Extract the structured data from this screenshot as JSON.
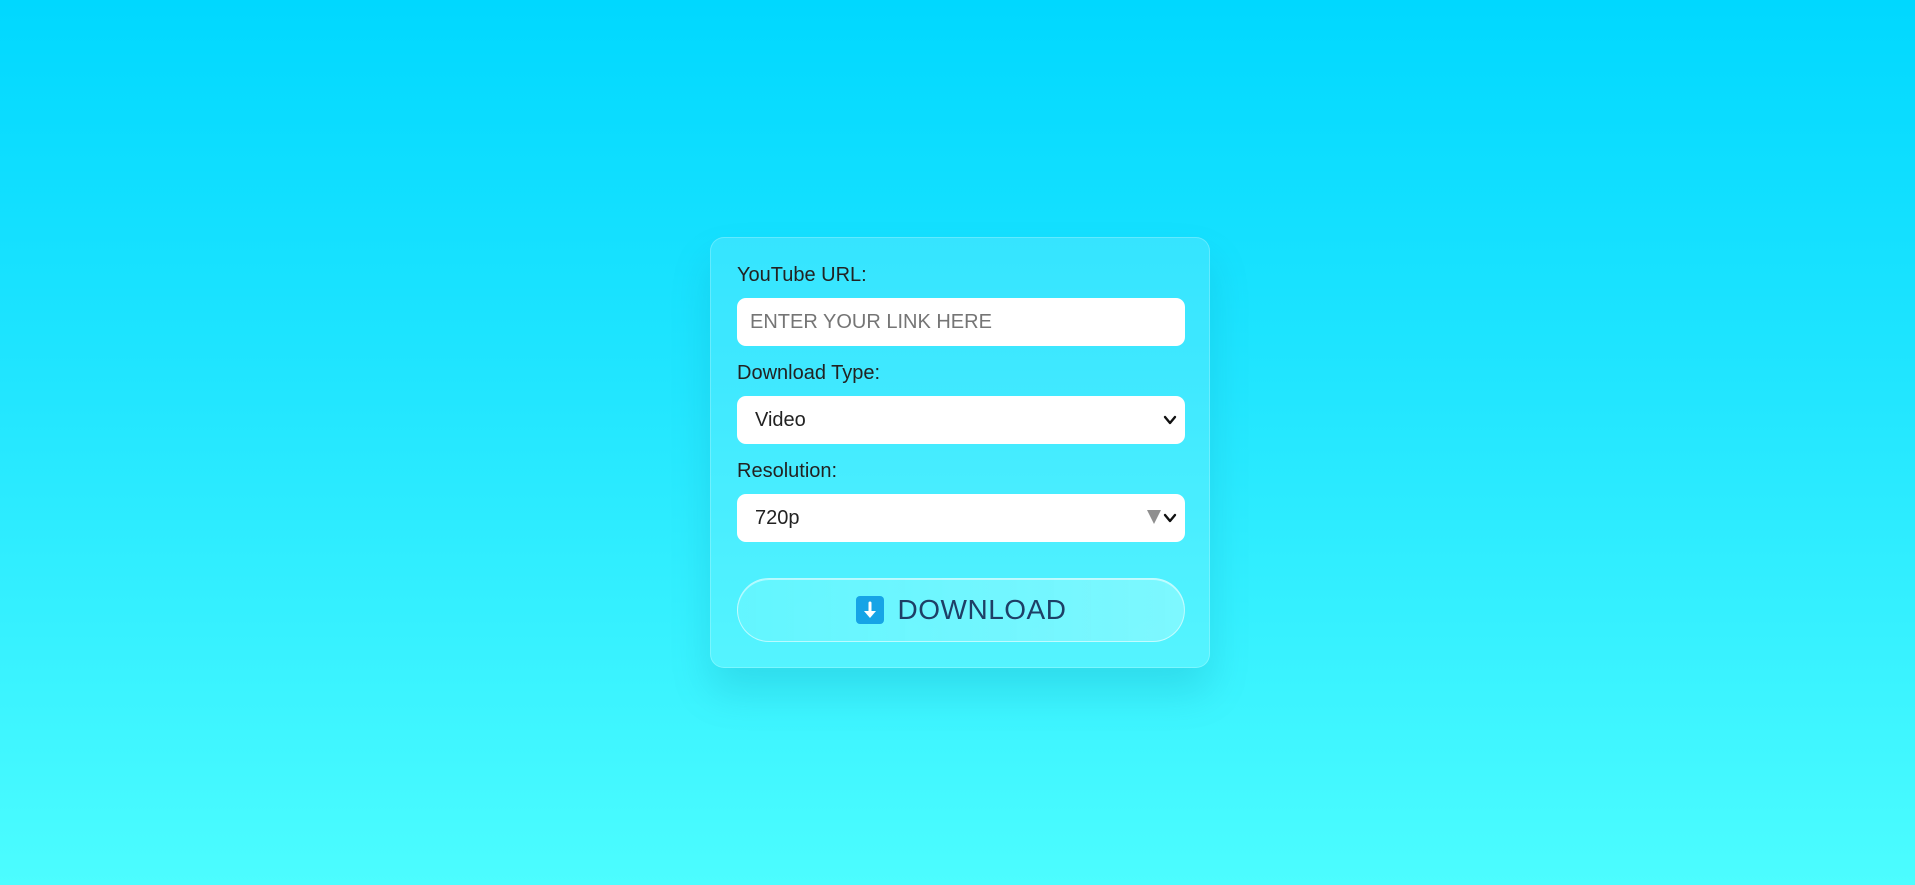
{
  "form": {
    "url_label": "YouTube URL:",
    "url_placeholder": "ENTER YOUR LINK HERE",
    "url_value": "",
    "type_label": "Download Type:",
    "type_selected": "Video",
    "resolution_label": "Resolution:",
    "resolution_selected": "720p",
    "download_button": "DOWNLOAD"
  },
  "icons": {
    "download": "download-arrow-icon",
    "select_chevron": "chevron-down-icon",
    "resolution_triangle": "triangle-down-icon"
  },
  "colors": {
    "background_top": "#00d8ff",
    "background_bottom": "#4cfdff",
    "download_icon_bg": "#16a4e6",
    "download_text": "#1e3f66"
  }
}
